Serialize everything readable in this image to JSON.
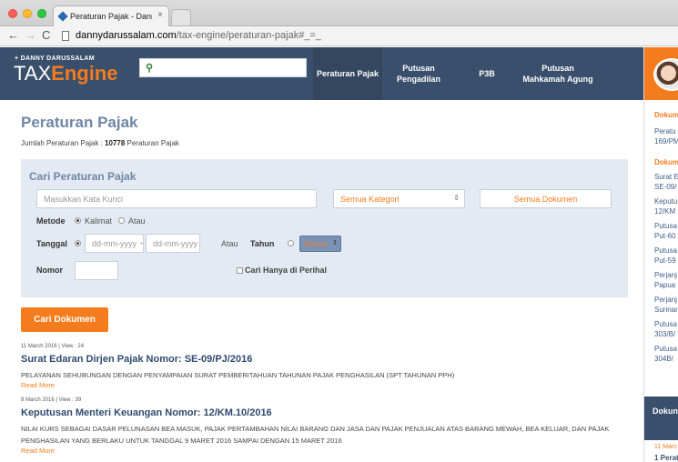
{
  "browser": {
    "tab_title": "Peraturan Pajak - Danny Da",
    "tab_close": "×",
    "url_host": "dannydarussalam.com",
    "url_path": "/tax-engine/peraturan-pajak#_=_",
    "nav_back": "←",
    "nav_forward": "→",
    "nav_reload": "C"
  },
  "header": {
    "logo_sub": "+ DANNY DARUSSALAM",
    "logo_tax": "TAX",
    "logo_engine": "Engine",
    "search_icon": "magnifier",
    "nav": [
      {
        "label": "Peraturan Pajak",
        "active": true
      },
      {
        "label": "Putusan Pengadilan"
      },
      {
        "label": "P3B"
      },
      {
        "label": "Putusan Mahkamah Agung"
      }
    ]
  },
  "main": {
    "title": "Peraturan Pajak",
    "count_prefix": "Jumlah Peraturan Pajak : ",
    "count_value": "10778",
    "count_suffix": " Peraturan Pajak"
  },
  "search": {
    "title": "Cari Peraturan Pajak",
    "keyword_placeholder": "Masukkan Kata Kunci",
    "kategori_value": "Semua Kategori",
    "dokumen_value": "Semua Dokumen",
    "metode_label": "Metode",
    "metode_opt1": "Kalimat",
    "metode_opt2": "Atau",
    "tanggal_label": "Tanggal",
    "date_from": "dd-mm-yyyy",
    "date_sep": "-",
    "date_to": "dd-mm-yyyy",
    "atau_label": "Atau",
    "tahun_label": "Tahun",
    "tahun_value": "Semua",
    "nomor_label": "Nomor",
    "perihal_label": "Cari Hanya di Perihal",
    "submit_label": "Cari Dokumen"
  },
  "results": [
    {
      "meta": "11 March 2016 | View : 24",
      "title": "Surat Edaran Dirjen Pajak Nomor: SE-09/PJ/2016",
      "desc": "PELAYANAN SEHUBUNGAN DENGAN PENYAMPAIAN SURAT PEMBERITAHUAN TAHUNAN PAJAK PENGHASILAN (SPT TAHUNAN PPH)",
      "more": "Read More"
    },
    {
      "meta": "8 March 2016 | View : 39",
      "title": "Keputusan Menteri Keuangan Nomor: 12/KM.10/2016",
      "desc": "NILAI KURS SEBAGAI DASAR PELUNASAN BEA MASUK, PAJAK PERTAMBAHAN NILAI BARANG DAN JASA DAN PAJAK PENJUALAN ATAS BARANG MEWAH, BEA KELUAR, DAN PAJAK PENGHASILAN YANG BERLAKU UNTUK TANGGAL 9 MARET 2016 SAMPAI DENGAN 15 MARET 2016",
      "more": "Read More"
    }
  ],
  "right_col": {
    "head1": "Dokum",
    "items1": [
      "Peratu",
      "169/PM"
    ],
    "head2": "Dokum",
    "items2": [
      "Surat E",
      "SE-09/",
      "Keputu",
      "12/KM",
      "Putusa",
      "Put-60",
      "Putusa",
      "Put-59",
      "Perjanj",
      "Papua",
      "Perjanj",
      "Surinar",
      "Putusa",
      "303/B/",
      "Putusa",
      "304B/"
    ],
    "block_label": "Dokun",
    "date": "11 Marc",
    "first": "1 Perat"
  }
}
